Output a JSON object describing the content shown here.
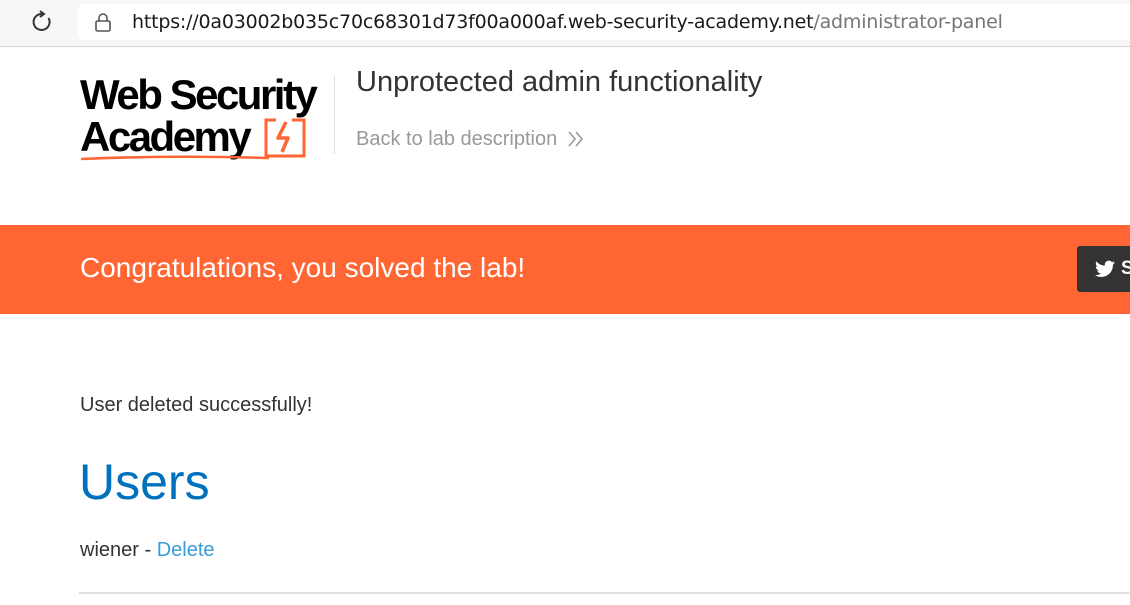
{
  "browser": {
    "url_host": "https://0a03002b035c70c68301d73f00a000af.web-security-academy.net",
    "url_path": "/administrator-panel"
  },
  "header": {
    "logo_line1": "Web Security",
    "logo_line2": "Academy",
    "lab_title": "Unprotected admin functionality",
    "back_link": "Back to lab description"
  },
  "banner": {
    "text": "Congratulations, you solved the lab!",
    "share_label": "S"
  },
  "content": {
    "message": "User deleted successfully!",
    "heading": "Users",
    "users": [
      {
        "name": "wiener",
        "separator": " - ",
        "action": "Delete"
      }
    ]
  },
  "colors": {
    "accent": "#ff6633",
    "heading": "#0071bc",
    "link": "#3a9bd9",
    "muted": "#999999"
  }
}
